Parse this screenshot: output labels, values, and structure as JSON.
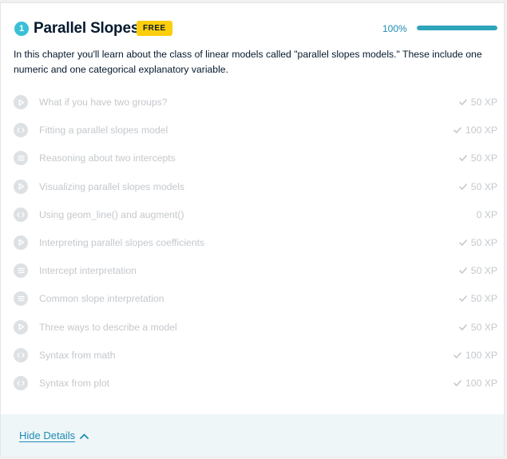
{
  "chapter": {
    "number": "1",
    "title": "Parallel Slopes",
    "badge": "FREE",
    "progress_text": "100%",
    "progress_fraction": 1.0,
    "description": "In this chapter you'll learn about the class of linear models called \"parallel slopes models.\" These include one numeric and one categorical explanatory variable."
  },
  "exercises": [
    {
      "icon": "video-icon",
      "title": "What if you have two groups?",
      "xp": "50 XP",
      "completed": true
    },
    {
      "icon": "code-icon",
      "title": "Fitting a parallel slopes model",
      "xp": "100 XP",
      "completed": true
    },
    {
      "icon": "multiple-choice-icon",
      "title": "Reasoning about two intercepts",
      "xp": "50 XP",
      "completed": true
    },
    {
      "icon": "video-icon",
      "title": "Visualizing parallel slopes models",
      "xp": "50 XP",
      "completed": true
    },
    {
      "icon": "code-icon",
      "title": "Using geom_line() and augment()",
      "xp": "0 XP",
      "completed": false
    },
    {
      "icon": "video-icon",
      "title": "Interpreting parallel slopes coefficients",
      "xp": "50 XP",
      "completed": true
    },
    {
      "icon": "multiple-choice-icon",
      "title": "Intercept interpretation",
      "xp": "50 XP",
      "completed": true
    },
    {
      "icon": "multiple-choice-icon",
      "title": "Common slope interpretation",
      "xp": "50 XP",
      "completed": true
    },
    {
      "icon": "video-icon",
      "title": "Three ways to describe a model",
      "xp": "50 XP",
      "completed": true
    },
    {
      "icon": "code-icon",
      "title": "Syntax from math",
      "xp": "100 XP",
      "completed": true
    },
    {
      "icon": "code-icon",
      "title": "Syntax from plot",
      "xp": "100 XP",
      "completed": true
    }
  ],
  "footer": {
    "hide_details_label": "Hide Details"
  },
  "colors": {
    "accent": "#3ac0d6",
    "progress": "#2ea5ba",
    "badge": "#fcce0d",
    "link": "#1f8bb4",
    "muted": "#c4c8cc"
  }
}
